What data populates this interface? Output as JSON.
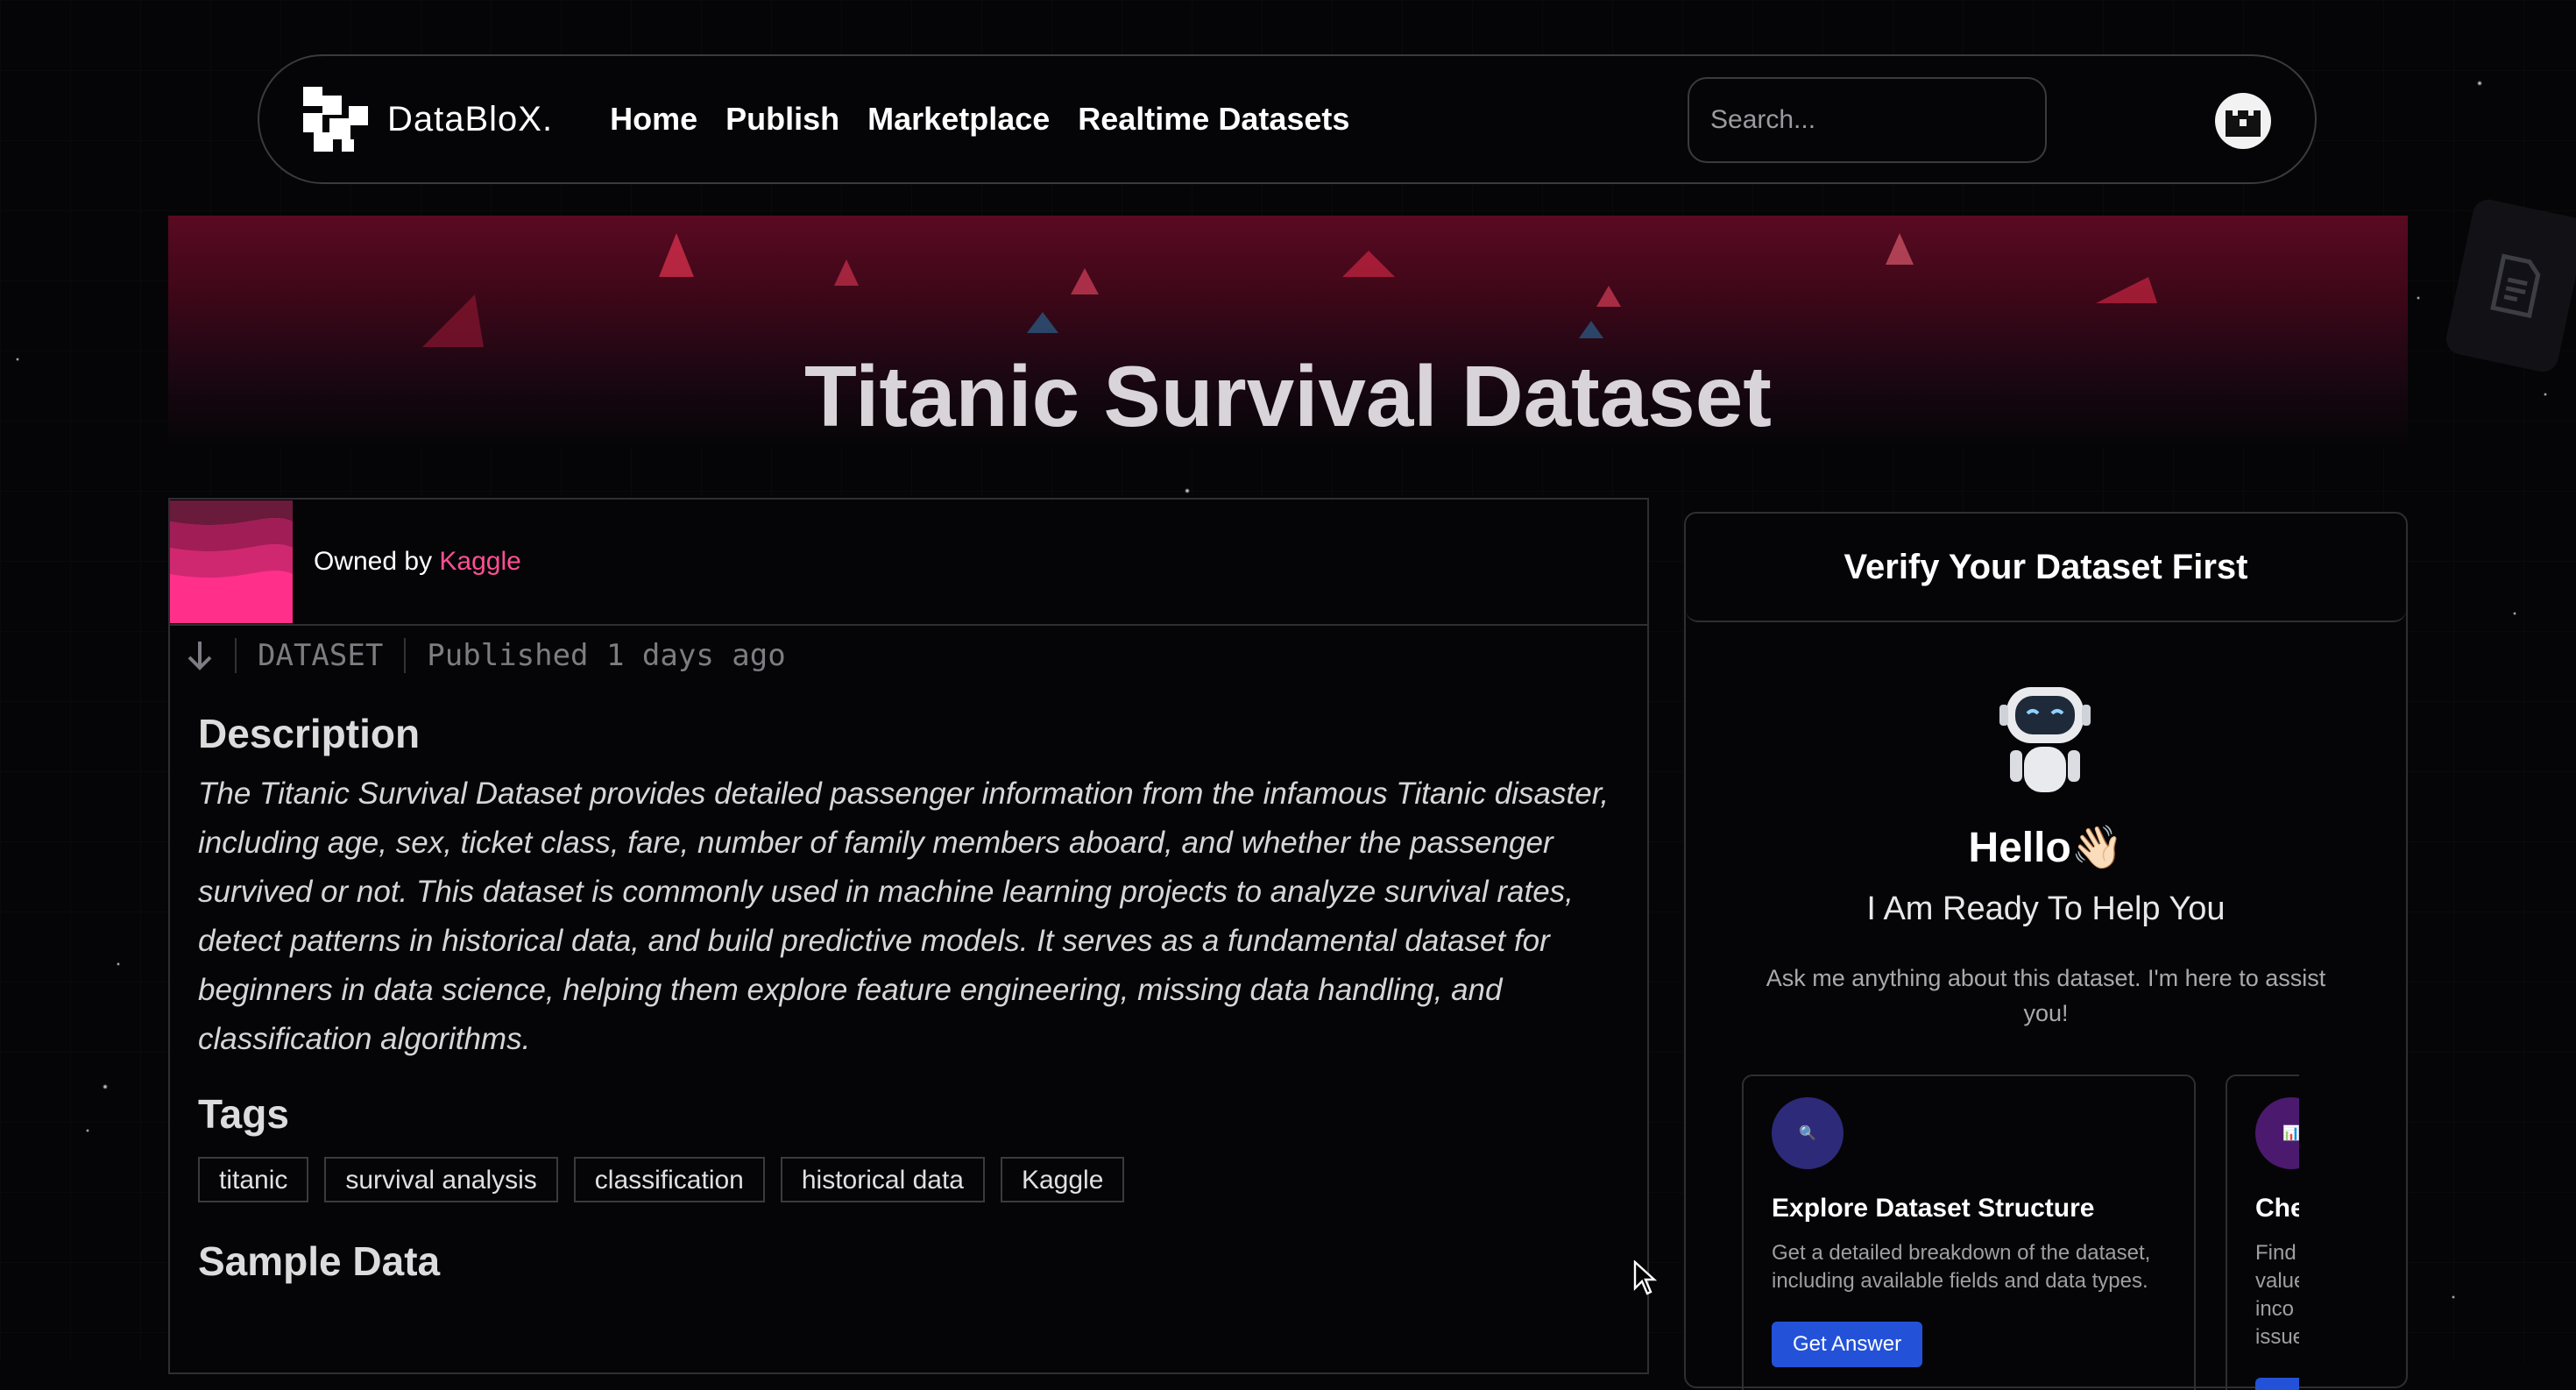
{
  "brand": {
    "name": "DataBloX",
    "dot": "."
  },
  "nav": {
    "links": [
      "Home",
      "Publish",
      "Marketplace",
      "Realtime Datasets"
    ]
  },
  "search": {
    "placeholder": "Search..."
  },
  "hero": {
    "title": "Titanic Survival Dataset"
  },
  "dataset": {
    "owner_prefix": "Owned by",
    "owner": "Kaggle",
    "type": "DATASET",
    "published": "Published 1 days ago",
    "description_heading": "Description",
    "description": "The Titanic Survival Dataset provides detailed passenger information from the infamous Titanic disaster, including age, sex, ticket class, fare, number of family members aboard, and whether the passenger survived or not. This dataset is commonly used in machine learning projects to analyze survival rates, detect patterns in historical data, and build predictive models. It serves as a fundamental dataset for beginners in data science, helping them explore feature engineering, missing data handling, and classification algorithms.",
    "tags_heading": "Tags",
    "tags": [
      "titanic",
      "survival analysis",
      "classification",
      "historical data",
      "Kaggle"
    ],
    "sample_heading": "Sample Data"
  },
  "assistant": {
    "header": "Verify Your Dataset First",
    "hello": "Hello👋🏻",
    "ready": "I Am Ready To Help You",
    "ask": "Ask me anything about this dataset. I'm here to assist you!",
    "cards": [
      {
        "icon": "🔍",
        "title": "Explore Dataset Structure",
        "text": "Get a detailed breakdown of the dataset, including available fields and data types.",
        "button": "Get Answer",
        "color": "#2e2a7a"
      },
      {
        "icon": "📊",
        "title": "Check Da",
        "text": "Find out if t values, inco issues.",
        "button": "",
        "color": "#4b1a6e"
      }
    ]
  }
}
